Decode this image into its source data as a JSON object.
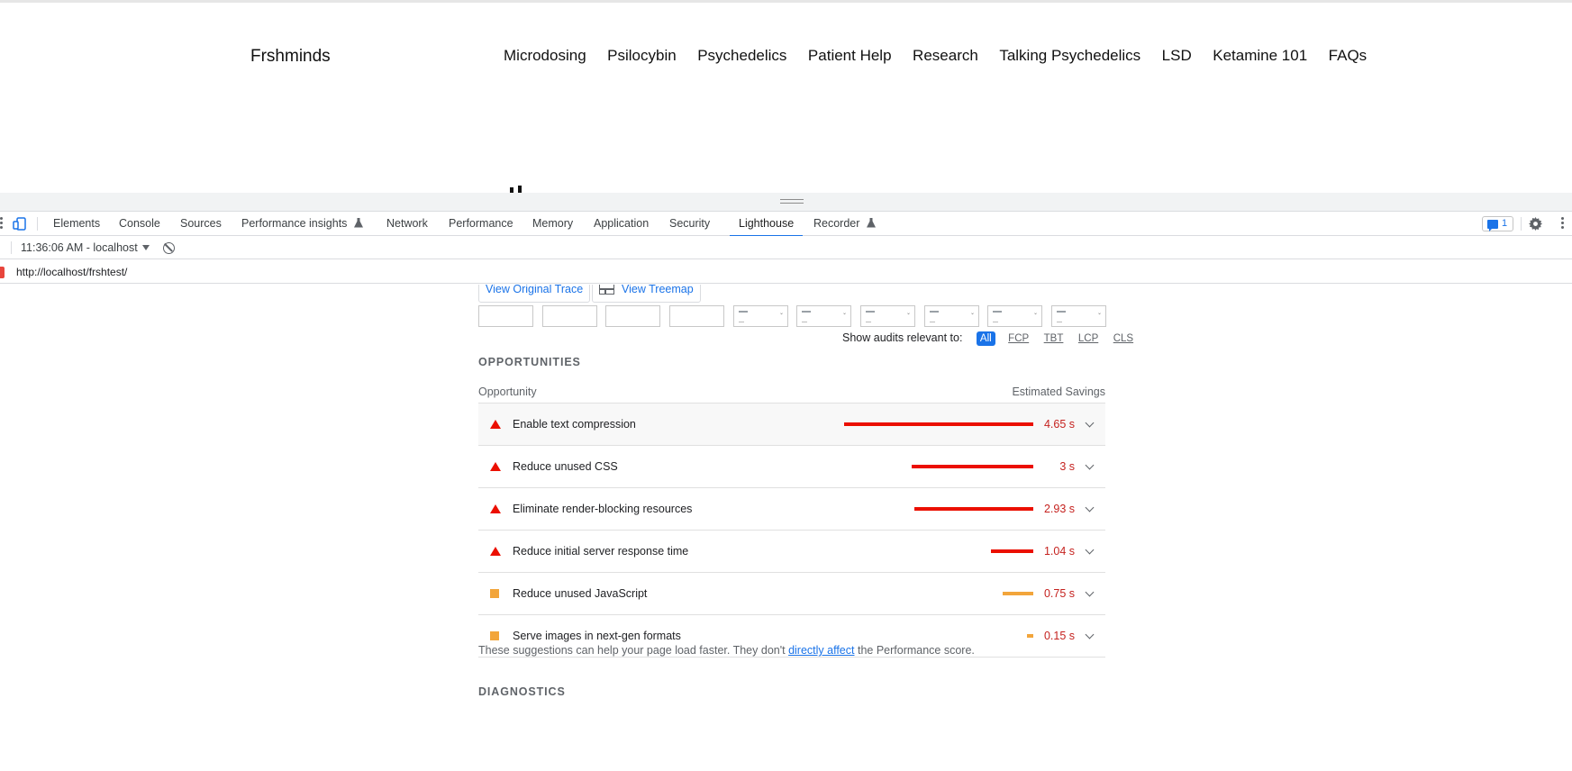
{
  "site": {
    "logo": "Frshminds",
    "nav": [
      "Microdosing",
      "Psilocybin",
      "Psychedelics",
      "Patient Help",
      "Research",
      "Talking Psychedelics",
      "LSD",
      "Ketamine 101",
      "FAQs"
    ]
  },
  "devtools": {
    "tabs": [
      {
        "label": "Elements"
      },
      {
        "label": "Console"
      },
      {
        "label": "Sources"
      },
      {
        "label": "Performance insights",
        "experimental": true
      },
      {
        "label": "Network"
      },
      {
        "label": "Performance"
      },
      {
        "label": "Memory"
      },
      {
        "label": "Application"
      },
      {
        "label": "Security"
      },
      {
        "label": "Lighthouse",
        "active": true
      },
      {
        "label": "Recorder",
        "experimental": true
      }
    ],
    "issues_count": "1",
    "report_selector": "11:36:06 AM - localhost",
    "url": "http://localhost/frshtest/"
  },
  "report": {
    "view_trace_label": "View Original Trace",
    "view_treemap_label": "View Treemap",
    "filter_label": "Show audits relevant to:",
    "filters": [
      {
        "label": "All",
        "active": true
      },
      {
        "label": "FCP"
      },
      {
        "label": "TBT"
      },
      {
        "label": "LCP"
      },
      {
        "label": "CLS"
      }
    ],
    "opportunities_title": "OPPORTUNITIES",
    "col_opportunity": "Opportunity",
    "col_savings": "Estimated Savings",
    "opportunities": [
      {
        "title": "Enable text compression",
        "savings": "4.65 s",
        "savings_s": 4.65,
        "rating": "fail",
        "color": "#eb0f00"
      },
      {
        "title": "Reduce unused CSS",
        "savings": "3 s",
        "savings_s": 3.0,
        "rating": "fail",
        "color": "#eb0f00"
      },
      {
        "title": "Eliminate render-blocking resources",
        "savings": "2.93 s",
        "savings_s": 2.93,
        "rating": "fail",
        "color": "#eb0f00"
      },
      {
        "title": "Reduce initial server response time",
        "savings": "1.04 s",
        "savings_s": 1.04,
        "rating": "fail",
        "color": "#eb0f00"
      },
      {
        "title": "Reduce unused JavaScript",
        "savings": "0.75 s",
        "savings_s": 0.75,
        "rating": "average",
        "color": "#f2a53b"
      },
      {
        "title": "Serve images in next-gen formats",
        "savings": "0.15 s",
        "savings_s": 0.15,
        "rating": "average",
        "color": "#f2a53b"
      }
    ],
    "footnote_pre": "These suggestions can help your page load faster. They don't",
    "footnote_link": "directly affect",
    "footnote_post": "the Performance score.",
    "diagnostics_title": "DIAGNOSTICS"
  },
  "colors": {
    "accent": "#1a73e8",
    "fail": "#eb0f00",
    "average": "#f2a53b"
  }
}
